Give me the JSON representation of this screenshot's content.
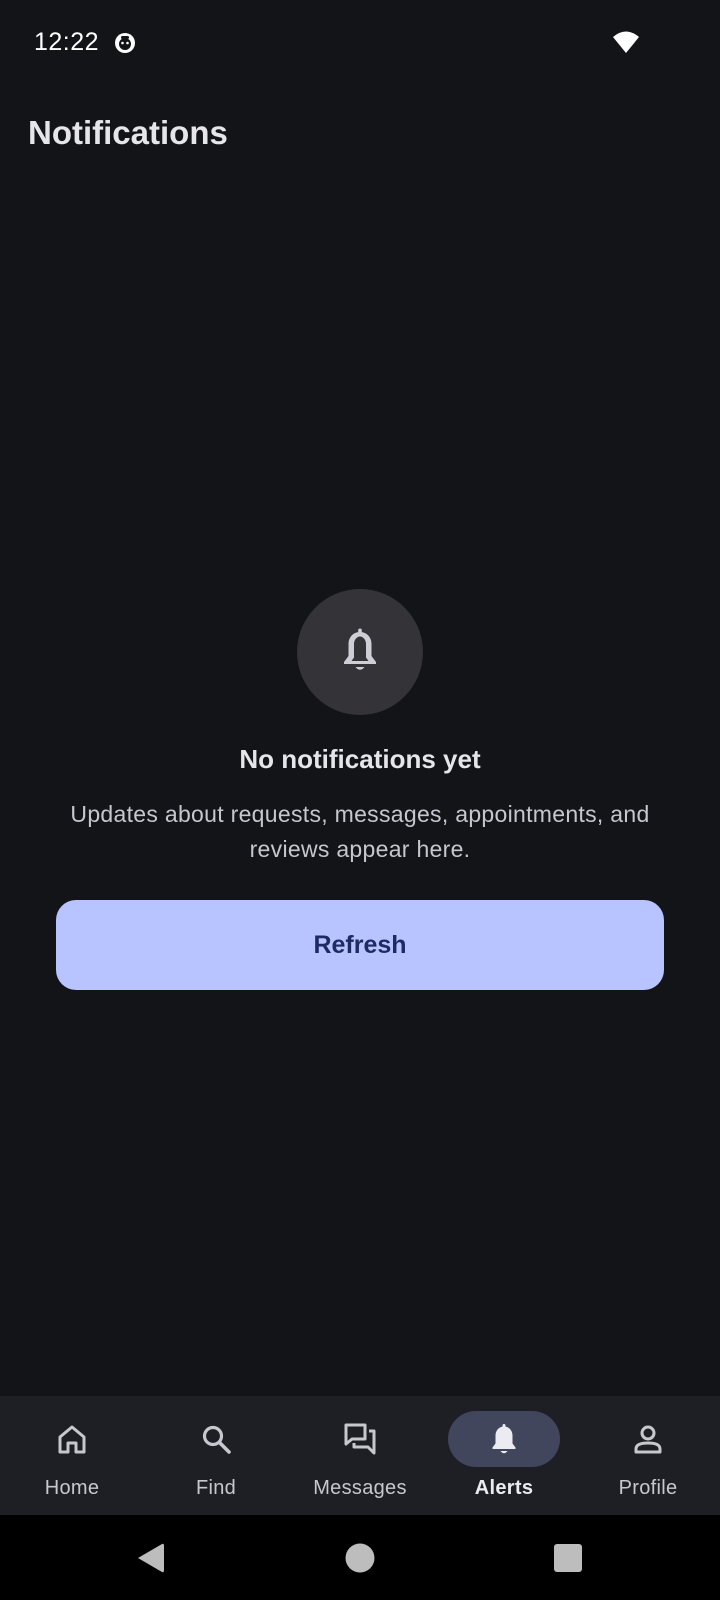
{
  "status_bar": {
    "time": "12:22",
    "icons": [
      "app-notification-icon",
      "wifi-icon"
    ]
  },
  "header": {
    "title": "Notifications"
  },
  "empty_state": {
    "icon": "bell-icon",
    "title": "No notifications yet",
    "description": "Updates about requests, messages, appointments, and reviews appear here.",
    "button_label": "Refresh"
  },
  "bottom_nav": {
    "items": [
      {
        "label": "Home",
        "icon": "home-icon",
        "active": false
      },
      {
        "label": "Find",
        "icon": "search-icon",
        "active": false
      },
      {
        "label": "Messages",
        "icon": "messages-icon",
        "active": false
      },
      {
        "label": "Alerts",
        "icon": "bell-icon",
        "active": true
      },
      {
        "label": "Profile",
        "icon": "profile-icon",
        "active": false
      }
    ]
  },
  "system_nav": {
    "icons": [
      "back-icon",
      "home-circle-icon",
      "recents-icon"
    ]
  },
  "colors": {
    "background": "#131418",
    "accent_button": "#b8c4ff",
    "accent_button_text": "#1c2a66",
    "nav_background": "#1e1f25",
    "nav_active_pill": "#41465d"
  }
}
